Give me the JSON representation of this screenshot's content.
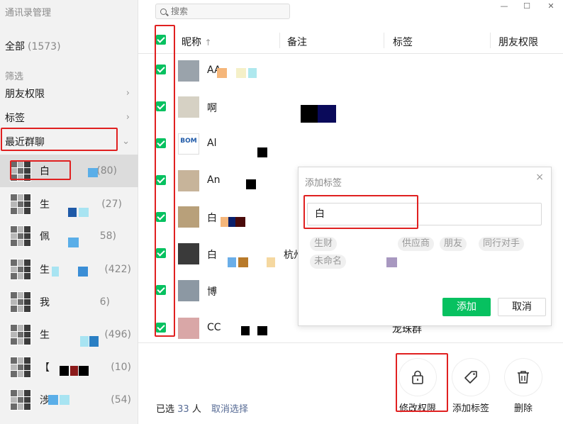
{
  "app": {
    "title": "通讯录管理"
  },
  "window": {
    "minimize": "—",
    "maximize": "☐",
    "close": "✕"
  },
  "sidebar": {
    "all_label": "全部",
    "all_count": "(1573)",
    "filter_section": "筛选",
    "filters": [
      {
        "label": "朋友权限",
        "chevron": "›"
      },
      {
        "label": "标签",
        "chevron": "›"
      },
      {
        "label": "最近群聊",
        "chevron": "⌄"
      }
    ],
    "groups": [
      {
        "name": "白",
        "count": "(80)",
        "selected": true
      },
      {
        "name": "生",
        "count": "(27)"
      },
      {
        "name": "佩",
        "count": "58)"
      },
      {
        "name": "生",
        "count": "(422)"
      },
      {
        "name": "我",
        "count": "6)"
      },
      {
        "name": "生",
        "count": "(496)"
      },
      {
        "name": "【",
        "count": "(10)"
      },
      {
        "name": "涉",
        "count": "(54)"
      }
    ]
  },
  "search": {
    "placeholder": "搜索"
  },
  "table": {
    "columns": {
      "nickname": "昵称",
      "sort_icon": "↑",
      "remark": "备注",
      "tag": "标签",
      "permission": "朋友权限"
    },
    "rows": [
      {
        "name": "AA",
        "tag": ""
      },
      {
        "name": "啊",
        "tag": ""
      },
      {
        "name": "Al",
        "tag": ""
      },
      {
        "name": "An",
        "tag": ""
      },
      {
        "name": "白",
        "tag": ""
      },
      {
        "name": "白",
        "tag": "",
        "extra": "杭州"
      },
      {
        "name": "博",
        "tag": ""
      },
      {
        "name": "CC",
        "tag": "龙珠群"
      }
    ]
  },
  "popup": {
    "title": "添加标签",
    "close": "×",
    "input_value": "白",
    "chips": [
      "生财",
      "供应商",
      "朋友",
      "同行对手",
      "未命名"
    ],
    "add_label": "添加",
    "cancel_label": "取消"
  },
  "footer": {
    "selected_prefix": "已选",
    "selected_count": "33",
    "selected_suffix": "人",
    "deselect_label": "取消选择",
    "actions": [
      {
        "label": "修改权限",
        "icon": "lock-icon"
      },
      {
        "label": "添加标签",
        "icon": "tag-icon"
      },
      {
        "label": "删除",
        "icon": "trash-icon"
      }
    ]
  },
  "colors": {
    "accent": "#07c160",
    "link": "#576b95",
    "highlight": "#e02020"
  }
}
